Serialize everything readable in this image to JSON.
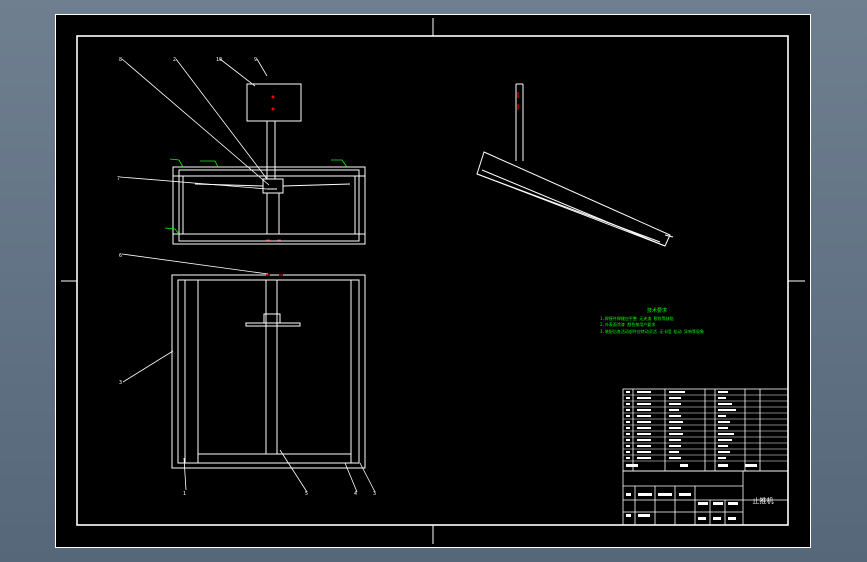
{
  "colors": {
    "paper": "#000000",
    "line": "#ffffff",
    "annotation": "#00ff00",
    "marker": "#ff0000",
    "window_bg": "#5d6d7e"
  },
  "notes": {
    "heading": "技术要求",
    "line1": "1.焊接件焊缝应平整 无夹渣 裂纹等缺陷",
    "line2": "2.外表面涂漆 颜色按用户要求",
    "line3": "3.装配后各活动部件应转动灵活 无卡阻 松动 异响等现象"
  },
  "title_block": {
    "drawing_title": "止推机"
  }
}
